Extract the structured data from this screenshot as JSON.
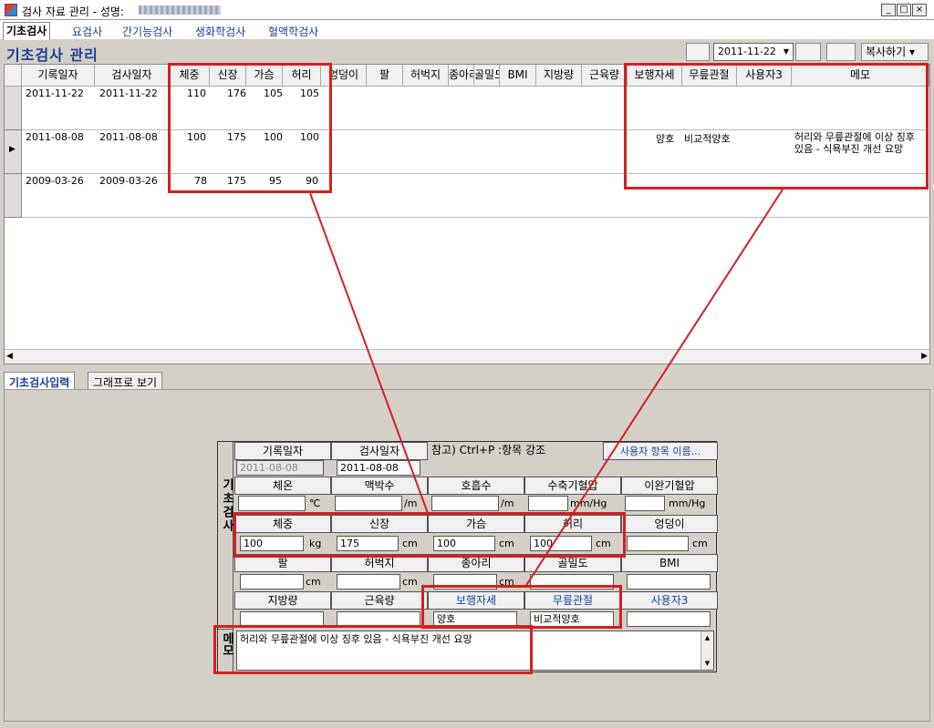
{
  "window": {
    "title": "검사 자료 관리 - 성명:",
    "min": "_",
    "max": "□",
    "close": "×"
  },
  "tabs": [
    "기초검사",
    "요검사",
    "간기능검사",
    "생화학검사",
    "혈액학검사"
  ],
  "section_title": "기초검사 관리",
  "toolbar": {
    "date": "2011-11-22",
    "copy": "복사하기"
  },
  "grid": {
    "headers": [
      "기록일자",
      "검사일자",
      "체중",
      "신장",
      "가슴",
      "허리",
      "엉덩이",
      "팔",
      "허벅지",
      "종아리",
      "골밀도",
      "BMI",
      "지방량",
      "근육량",
      "보행자세",
      "무릎관절",
      "사용자3",
      "메모"
    ],
    "rows": [
      {
        "rec": "2011-11-22",
        "exam": "2011-11-22",
        "w": "110",
        "h": "176",
        "c": "105",
        "wa": "105",
        "gait": "",
        "knee": "",
        "memo": ""
      },
      {
        "rec": "2011-08-08",
        "exam": "2011-08-08",
        "w": "100",
        "h": "175",
        "c": "100",
        "wa": "100",
        "gait": "양호",
        "knee": "비교적양호",
        "memo": "허리와 무릎관절에 이상 징후 있음 - 식욕부진 개선 요망"
      },
      {
        "rec": "2009-03-26",
        "exam": "2009-03-26",
        "w": "78",
        "h": "175",
        "c": "95",
        "wa": "90",
        "gait": "",
        "knee": "",
        "memo": ""
      }
    ]
  },
  "lower_tabs": [
    "기초검사입력",
    "그래프로 보기"
  ],
  "form": {
    "side_label": "기초검사",
    "memo_side": "메모",
    "rec_label": "기록일자",
    "exam_label": "검사일자",
    "note": "참고) Ctrl+P :항목 강조",
    "user_btn": "사용자 항목 이름...",
    "rec_val": "2011-08-08",
    "exam_val": "2011-08-08",
    "r1": [
      "체온",
      "맥박수",
      "호흡수",
      "수축기혈압",
      "이완기혈압"
    ],
    "r1u": [
      "℃",
      "/m",
      "/m",
      "mm/Hg",
      "mm/Hg"
    ],
    "r2": [
      "체중",
      "신장",
      "가슴",
      "허리",
      "엉덩이"
    ],
    "r2v": [
      "100",
      "175",
      "100",
      "100",
      ""
    ],
    "r2u": [
      "kg",
      "cm",
      "cm",
      "cm",
      "cm"
    ],
    "r3": [
      "팔",
      "허벅지",
      "종아리",
      "골밀도",
      "BMI"
    ],
    "r3u": [
      "cm",
      "cm",
      "cm",
      "",
      ""
    ],
    "r4": [
      "지방량",
      "근육량",
      "보행자세",
      "무릎관절",
      "사용자3"
    ],
    "r4v": [
      "",
      "",
      "양호",
      "비교적양호",
      ""
    ],
    "memo": "허리와 무릎관절에 이상 징후 있음 - 식욕부진 개선 요망"
  },
  "colors": {
    "accent": "#1b3f9a",
    "highlight": "#d42020"
  }
}
